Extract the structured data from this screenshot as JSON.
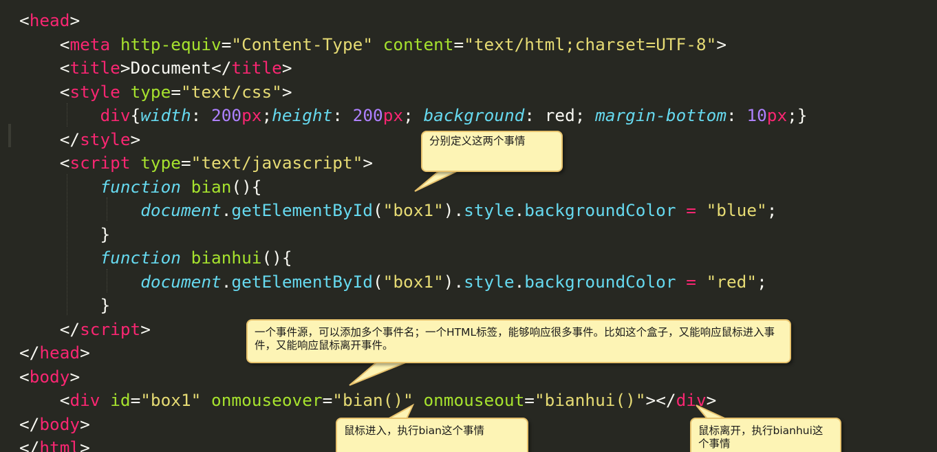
{
  "code_lines": [
    [
      [
        "t-p",
        "<"
      ],
      [
        "t-tag",
        "head"
      ],
      [
        "t-p",
        ">"
      ]
    ],
    [
      [
        "t-p",
        "    <"
      ],
      [
        "t-tag",
        "meta"
      ],
      [
        "t-p",
        " "
      ],
      [
        "t-attr",
        "http-equiv"
      ],
      [
        "t-p",
        "="
      ],
      [
        "t-str",
        "\"Content-Type\""
      ],
      [
        "t-p",
        " "
      ],
      [
        "t-attr",
        "content"
      ],
      [
        "t-p",
        "="
      ],
      [
        "t-str",
        "\"text/html;charset=UTF-8\""
      ],
      [
        "t-p",
        ">"
      ]
    ],
    [
      [
        "t-p",
        "    <"
      ],
      [
        "t-tag",
        "title"
      ],
      [
        "t-p",
        ">Document</"
      ],
      [
        "t-tag",
        "title"
      ],
      [
        "t-p",
        ">"
      ]
    ],
    [
      [
        "t-p",
        "    <"
      ],
      [
        "t-tag",
        "style"
      ],
      [
        "t-p",
        " "
      ],
      [
        "t-attr",
        "type"
      ],
      [
        "t-p",
        "="
      ],
      [
        "t-str",
        "\"text/css\""
      ],
      [
        "t-p",
        ">"
      ]
    ],
    [
      [
        "t-p",
        "        "
      ],
      [
        "t-tag",
        "div"
      ],
      [
        "t-p",
        "{"
      ],
      [
        "t-ital",
        "width"
      ],
      [
        "t-p",
        ": "
      ],
      [
        "t-num",
        "200"
      ],
      [
        "t-tag",
        "px"
      ],
      [
        "t-p",
        ";"
      ],
      [
        "t-ital",
        "height"
      ],
      [
        "t-p",
        ": "
      ],
      [
        "t-num",
        "200"
      ],
      [
        "t-tag",
        "px"
      ],
      [
        "t-p",
        "; "
      ],
      [
        "t-ital",
        "background"
      ],
      [
        "t-p",
        ": red; "
      ],
      [
        "t-ital",
        "margin-bottom"
      ],
      [
        "t-p",
        ": "
      ],
      [
        "t-num",
        "10"
      ],
      [
        "t-tag",
        "px"
      ],
      [
        "t-p",
        ";}"
      ]
    ],
    [
      [
        "t-p",
        "    </"
      ],
      [
        "t-tag",
        "style"
      ],
      [
        "t-p",
        ">"
      ]
    ],
    [
      [
        "t-p",
        "    <"
      ],
      [
        "t-tag",
        "script"
      ],
      [
        "t-p",
        " "
      ],
      [
        "t-attr",
        "type"
      ],
      [
        "t-p",
        "="
      ],
      [
        "t-str",
        "\"text/javascript\""
      ],
      [
        "t-p",
        ">"
      ]
    ],
    [
      [
        "t-p",
        "        "
      ],
      [
        "t-kw",
        "function"
      ],
      [
        "t-p",
        " "
      ],
      [
        "t-fn",
        "bian"
      ],
      [
        "t-p",
        "(){"
      ]
    ],
    [
      [
        "t-p",
        "            "
      ],
      [
        "t-kw",
        "document"
      ],
      [
        "t-p",
        "."
      ],
      [
        "t-prop",
        "getElementById"
      ],
      [
        "t-p",
        "("
      ],
      [
        "t-str",
        "\"box1\""
      ],
      [
        "t-p",
        ")."
      ],
      [
        "t-prop",
        "style"
      ],
      [
        "t-p",
        "."
      ],
      [
        "t-prop",
        "backgroundColor"
      ],
      [
        "t-p",
        " "
      ],
      [
        "t-op",
        "="
      ],
      [
        "t-p",
        " "
      ],
      [
        "t-str",
        "\"blue\""
      ],
      [
        "t-p",
        ";"
      ]
    ],
    [
      [
        "t-p",
        "        }"
      ]
    ],
    [
      [
        "t-p",
        "        "
      ],
      [
        "t-kw",
        "function"
      ],
      [
        "t-p",
        " "
      ],
      [
        "t-fn",
        "bianhui"
      ],
      [
        "t-p",
        "(){"
      ]
    ],
    [
      [
        "t-p",
        "            "
      ],
      [
        "t-kw",
        "document"
      ],
      [
        "t-p",
        "."
      ],
      [
        "t-prop",
        "getElementById"
      ],
      [
        "t-p",
        "("
      ],
      [
        "t-str",
        "\"box1\""
      ],
      [
        "t-p",
        ")."
      ],
      [
        "t-prop",
        "style"
      ],
      [
        "t-p",
        "."
      ],
      [
        "t-prop",
        "backgroundColor"
      ],
      [
        "t-p",
        " "
      ],
      [
        "t-op",
        "="
      ],
      [
        "t-p",
        " "
      ],
      [
        "t-str",
        "\"red\""
      ],
      [
        "t-p",
        ";"
      ]
    ],
    [
      [
        "t-p",
        "        }"
      ]
    ],
    [
      [
        "t-p",
        "    </"
      ],
      [
        "t-tag",
        "script"
      ],
      [
        "t-p",
        ">"
      ]
    ],
    [
      [
        "t-p",
        "</"
      ],
      [
        "t-tag",
        "head"
      ],
      [
        "t-p",
        ">"
      ]
    ],
    [
      [
        "t-p",
        "<"
      ],
      [
        "t-tag",
        "body"
      ],
      [
        "t-p",
        ">"
      ]
    ],
    [
      [
        "t-p",
        "    <"
      ],
      [
        "t-tag",
        "div"
      ],
      [
        "t-p",
        " "
      ],
      [
        "t-attr",
        "id"
      ],
      [
        "t-p",
        "="
      ],
      [
        "t-str",
        "\"box1\""
      ],
      [
        "t-p",
        " "
      ],
      [
        "t-attr",
        "onmouseover"
      ],
      [
        "t-p",
        "="
      ],
      [
        "t-str",
        "\"bian()\""
      ],
      [
        "t-p",
        " "
      ],
      [
        "t-attr",
        "onmouseout"
      ],
      [
        "t-p",
        "="
      ],
      [
        "t-str",
        "\"bianhui()\""
      ],
      [
        "t-p",
        "></"
      ],
      [
        "t-tag",
        "div"
      ],
      [
        "t-p",
        ">"
      ]
    ],
    [
      [
        "t-p",
        "</"
      ],
      [
        "t-tag",
        "body"
      ],
      [
        "t-p",
        ">"
      ]
    ],
    [
      [
        "t-p",
        "</"
      ],
      [
        "t-tag",
        "html"
      ],
      [
        "t-p",
        ">"
      ]
    ]
  ],
  "callouts": {
    "define_events": "分别定义这两个事情",
    "event_source": "一个事件源，可以添加多个事件名；一个HTML标签，能够响应很多事件。比如这个盒子，又能响应鼠标进入事件，又能响应鼠标离开事件。",
    "mouse_enter": "鼠标进入，执行bian这个事情",
    "mouse_leave": "鼠标离开，执行bianhui这个事情"
  },
  "colors": {
    "background": "#272822",
    "tag": "#f92672",
    "attribute": "#a6e22e",
    "string": "#e6db74",
    "keyword": "#66d9ef",
    "number": "#ae81ff",
    "callout_fill": "#fdf4b5",
    "callout_border": "#e8c36e"
  }
}
